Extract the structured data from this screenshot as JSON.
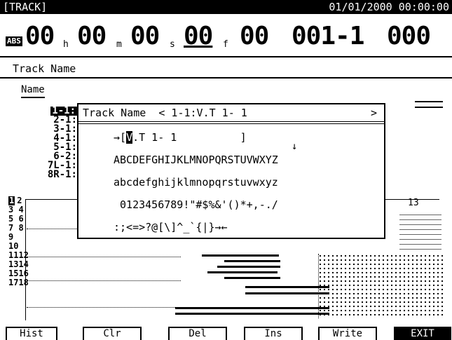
{
  "screen_title": "[TRACK]",
  "date_time": "01/01/2000 00:00:00",
  "time_display": {
    "badge": "ABS",
    "hours": "00",
    "hours_unit": "h",
    "minutes": "00",
    "minutes_unit": "m",
    "seconds": "00",
    "seconds_unit": "s",
    "frames": "00",
    "frames_unit": "f",
    "subframes": "00",
    "measure": "001-1",
    "tick": "000"
  },
  "section_title": "Track Name",
  "name_label": "Name",
  "track_list": [
    "1-1:",
    "2-1:",
    "3-1:",
    "4-1:",
    "5-1:",
    "6-2:",
    "7L-1:",
    "8R-1:"
  ],
  "track_numbers": [
    "1",
    "2",
    "3",
    "4",
    "5",
    "6",
    "7",
    "8",
    "9",
    "10",
    "11",
    "12",
    "13",
    "14",
    "15",
    "16",
    "17",
    "18"
  ],
  "right_label": "13",
  "dialog": {
    "title": "Track Name",
    "title_value": "< 1-1:V.T 1- 1",
    "title_arrow": ">",
    "entry_prefix": "→[",
    "entry_cursor": "V",
    "entry_rest": ".T 1- 1          ]",
    "column_arrow": "↓",
    "charset_upper": "ABCDEFGHIJKLMNOPQRSTUVWXYZ",
    "charset_lower": "abcdefghijklmnopqrstuvwxyz",
    "charset_digits": " 0123456789!\"#$%&'()*+,-./",
    "charset_symbols": ":;<=>?@[\\]^_`{|}→←"
  },
  "function_keys": [
    "Hist",
    "Clr",
    "Del",
    "Ins",
    "Write",
    "EXIT"
  ]
}
